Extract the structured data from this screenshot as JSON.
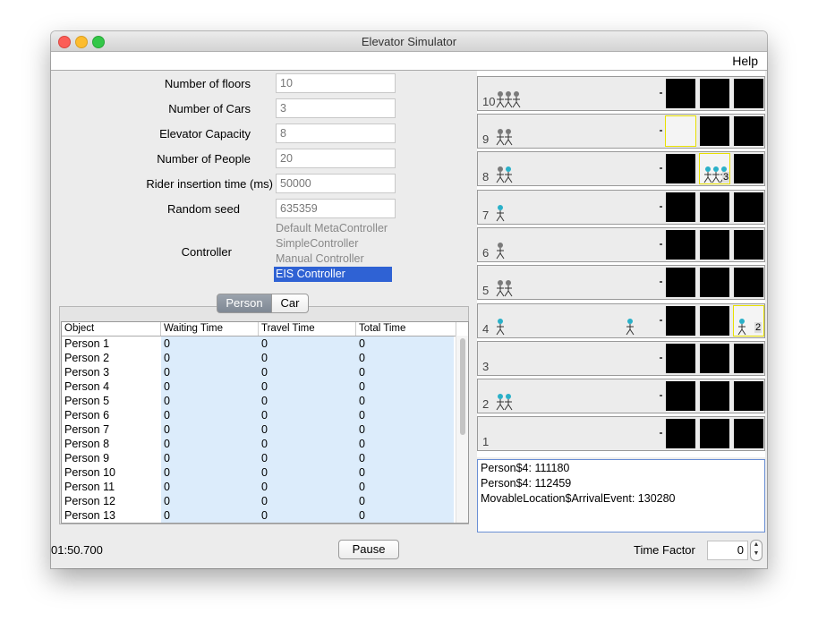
{
  "window": {
    "title": "Elevator Simulator"
  },
  "menu": {
    "help": "Help"
  },
  "form": {
    "fields": [
      {
        "label": "Number of floors",
        "value": "10"
      },
      {
        "label": "Number of Cars",
        "value": "3"
      },
      {
        "label": "Elevator Capacity",
        "value": "8"
      },
      {
        "label": "Number of People",
        "value": "20"
      },
      {
        "label": "Rider insertion time (ms)",
        "value": "50000"
      },
      {
        "label": "Random seed",
        "value": "635359"
      }
    ],
    "controller_label": "Controller",
    "controllers": [
      "Default MetaController",
      "SimpleController",
      "Manual Controller",
      "EIS Controller"
    ],
    "selected_controller": "EIS Controller"
  },
  "tabs": {
    "person": "Person",
    "car": "Car",
    "selected": "Person"
  },
  "table": {
    "columns": [
      "Object",
      "Waiting Time",
      "Travel Time",
      "Total Time"
    ],
    "rows": [
      [
        "Person 1",
        "0",
        "0",
        "0"
      ],
      [
        "Person 2",
        "0",
        "0",
        "0"
      ],
      [
        "Person 3",
        "0",
        "0",
        "0"
      ],
      [
        "Person 4",
        "0",
        "0",
        "0"
      ],
      [
        "Person 5",
        "0",
        "0",
        "0"
      ],
      [
        "Person 6",
        "0",
        "0",
        "0"
      ],
      [
        "Person 7",
        "0",
        "0",
        "0"
      ],
      [
        "Person 8",
        "0",
        "0",
        "0"
      ],
      [
        "Person 9",
        "0",
        "0",
        "0"
      ],
      [
        "Person 10",
        "0",
        "0",
        "0"
      ],
      [
        "Person 11",
        "0",
        "0",
        "0"
      ],
      [
        "Person 12",
        "0",
        "0",
        "0"
      ],
      [
        "Person 13",
        "0",
        "0",
        "0"
      ]
    ]
  },
  "status": {
    "clock": "01:50.700",
    "pause_label": "Pause",
    "time_factor_label": "Time Factor",
    "time_factor_value": "0"
  },
  "building": {
    "floors": [
      {
        "number": "10",
        "waiting_people": 3,
        "moving_people": 0
      },
      {
        "number": "9",
        "waiting_people": 2,
        "moving_people": 0
      },
      {
        "number": "8",
        "waiting_people": 1,
        "moving_people": 1
      },
      {
        "number": "7",
        "waiting_people": 0,
        "moving_people": 1
      },
      {
        "number": "6",
        "waiting_people": 1,
        "moving_people": 0
      },
      {
        "number": "5",
        "waiting_people": 2,
        "moving_people": 0
      },
      {
        "number": "4",
        "waiting_people": 0,
        "moving_people": 1
      },
      {
        "number": "3",
        "waiting_people": 0,
        "moving_people": 0
      },
      {
        "number": "2",
        "waiting_people": 0,
        "moving_people": 2
      },
      {
        "number": "1",
        "waiting_people": 0,
        "moving_people": 0
      }
    ],
    "car_badges": {
      "car2_floor8": "3",
      "car3_floor4": "2"
    }
  },
  "log": {
    "lines": [
      "Person$4: 111180",
      "Person$4: 112459",
      "MovableLocation$ArrivalEvent: 130280"
    ]
  },
  "colors": {
    "selection": "#2f62d4",
    "moving_person": "#2ab0c8",
    "waiting_person": "#7a7a7a",
    "shaft": "#000000",
    "door_highlight": "#e8e000"
  }
}
